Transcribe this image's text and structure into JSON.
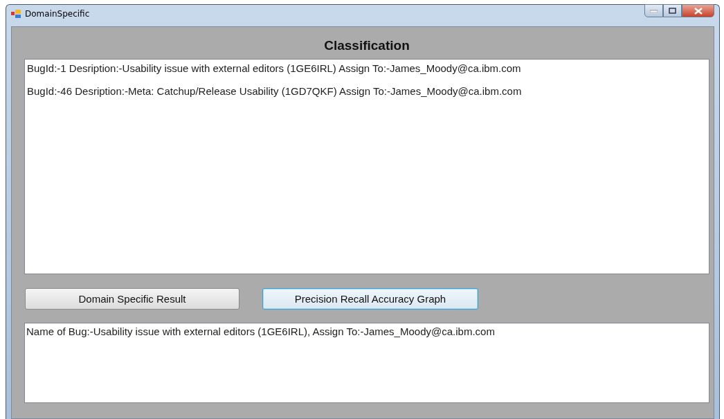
{
  "window": {
    "title": "DomainSpecific"
  },
  "heading": "Classification",
  "results": [
    "BugId:-1 Desription:-Usability issue with external editors (1GE6IRL) Assign To:-James_Moody@ca.ibm.com",
    "BugId:-46 Desription:-Meta: Catchup/Release Usability (1GD7QKF) Assign To:-James_Moody@ca.ibm.com"
  ],
  "buttons": [
    {
      "label": "Domain Specific Result",
      "focused": false
    },
    {
      "label": "Precision Recall Accuracy Graph",
      "focused": true
    }
  ],
  "output": "Name of Bug:-Usability issue with external editors (1GE6IRL), Assign To:-James_Moody@ca.ibm.com"
}
